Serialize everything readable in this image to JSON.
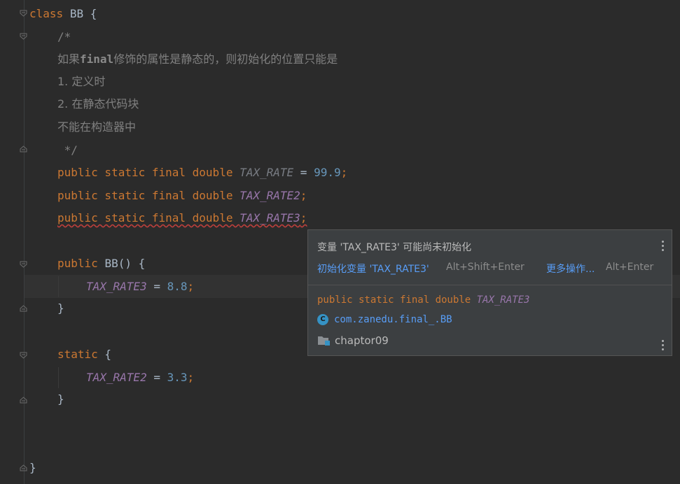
{
  "editor": {
    "line_class_header": {
      "kw": "class",
      "name": "BB",
      "brace": " {"
    },
    "comment_open": "/*",
    "comment_line1_a": "如果",
    "comment_line1_b": "final",
    "comment_line1_c": "修饰的属性是静态的，则初始化的位置只能是",
    "comment_line2": "1. 定义时",
    "comment_line3": "2. 在静态代码块",
    "comment_line4": "不能在构造器中",
    "comment_close": " */",
    "field1": {
      "mods": "public static final double ",
      "name": "TAX_RATE",
      "assign": " = ",
      "value": "99.9",
      "semi": ";"
    },
    "field2": {
      "mods": "public static final double ",
      "name": "TAX_RATE2",
      "semi": ";"
    },
    "field3": {
      "mods": "public static final double ",
      "name": "TAX_RATE3",
      "semi": ";"
    },
    "ctor": {
      "kw": "public ",
      "name": "BB",
      "rest": "() {"
    },
    "ctor_body": {
      "name": "TAX_RATE3",
      "assign": " = ",
      "value": "8.8",
      "semi": ";"
    },
    "ctor_close": "}",
    "static_block": {
      "kw": "static",
      "rest": " {"
    },
    "static_body": {
      "name": "TAX_RATE2",
      "assign": " = ",
      "value": "3.3",
      "semi": ";"
    },
    "static_close": "}",
    "class_close": "}"
  },
  "popup": {
    "title": "变量 'TAX_RATE3' 可能尚未初始化",
    "fix_action": "初始化变量 'TAX_RATE3'",
    "fix_shortcut": "Alt+Shift+Enter",
    "more_action": "更多操作...",
    "more_shortcut": "Alt+Enter",
    "decl_mods": "public static final double ",
    "decl_name": "TAX_RATE3",
    "class_icon_letter": "C",
    "package": "com.zanedu.final_.BB",
    "module": "chaptor09"
  },
  "colors": {
    "background": "#2b2b2b",
    "keyword": "#cc7832",
    "static_field": "#9876aa",
    "number": "#6897bb",
    "comment": "#808080",
    "link": "#589df6",
    "error_underline": "#bc3f3c"
  },
  "icons": [
    "fold-icon",
    "kebab-menu-icon",
    "class-icon",
    "module-folder-icon"
  ]
}
